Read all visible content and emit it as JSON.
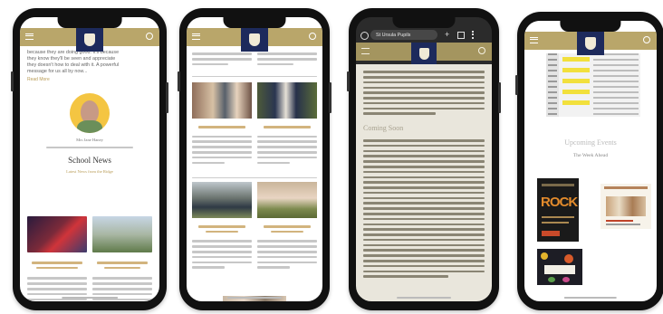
{
  "phone1": {
    "intro_lines": [
      "because they are doing good. It's because",
      "they know they'll be seen and appreciate",
      "they doesn't how to deal with it. A powerful",
      "message for us all by now..."
    ],
    "read_more": "Read More",
    "author_name": "Mrs Jane Haney",
    "section_title": "School News",
    "section_subtitle": "Latest News from the Ridge"
  },
  "phone3": {
    "browser_title": "St Ursula Pupils",
    "heading": "Coming Soon"
  },
  "phone4": {
    "heading": "Upcoming Events",
    "subheading": "The Week Ahead",
    "poster_text": "ROCK"
  }
}
